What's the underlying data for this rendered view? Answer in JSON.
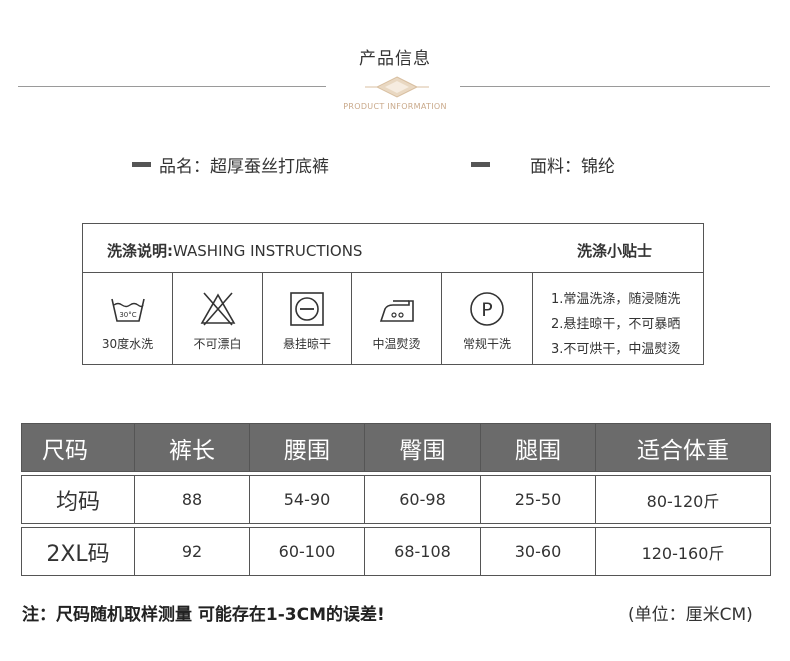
{
  "header": {
    "title": "产品信息",
    "subtitle": "PRODUCT INFORMATION"
  },
  "product": {
    "name": "品名：超厚蚕丝打底裤",
    "material": "面料：锦纶"
  },
  "washing": {
    "heading_cn": "洗涤说明:",
    "heading_en": "WASHING INSTRUCTIONS",
    "tips_heading": "洗涤小贴士",
    "icons": [
      {
        "icon": "wash-30-icon",
        "label": "30度水洗",
        "mark": "30°C"
      },
      {
        "icon": "no-bleach-icon",
        "label": "不可漂白"
      },
      {
        "icon": "hang-dry-icon",
        "label": "悬挂晾干"
      },
      {
        "icon": "iron-medium-icon",
        "label": "中温熨烫"
      },
      {
        "icon": "dry-clean-p-icon",
        "label": "常规干洗",
        "mark": "P"
      }
    ],
    "tips": [
      "1.常温洗涤，随浸随洗",
      "2.悬挂晾干，不可暴晒",
      "3.不可烘干，中温熨烫"
    ]
  },
  "size_table": {
    "headers": [
      "尺码",
      "裤长",
      "腰围",
      "臀围",
      "腿围",
      "适合体重"
    ],
    "rows": [
      [
        "均码",
        "88",
        "54-90",
        "60-98",
        "25-50",
        "80-120斤"
      ],
      [
        "2XL码",
        "92",
        "60-100",
        "68-108",
        "30-60",
        "120-160斤"
      ]
    ]
  },
  "footer": {
    "note": "注：尺码随机取样测量 可能存在1-3CM的误差!",
    "unit": "(单位：厘米CM)"
  }
}
